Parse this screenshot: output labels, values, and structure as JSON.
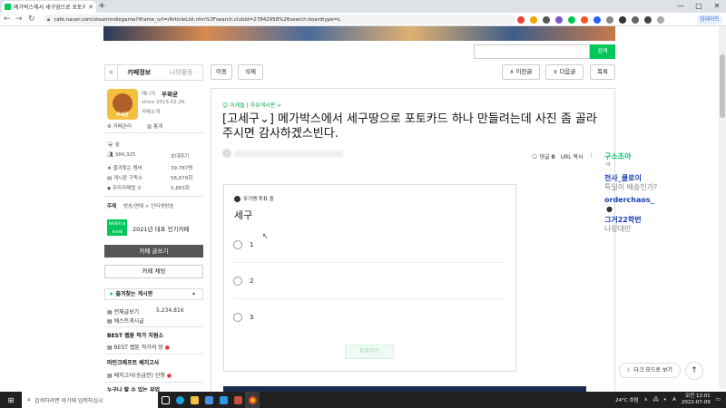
{
  "browser": {
    "tab_title": "메가박스에서 세구땅으로 포토카드",
    "new_tab": "+",
    "url": "cafe.naver.com/steamindiegame?iframe_url=/ArticleList.nhn%3Fsearch.clubid=27842958%26search.boardtype=L",
    "update_label": "업데이트"
  },
  "search": {
    "button": "검색",
    "placeholder": ""
  },
  "sidebar": {
    "tab_info": "카페정보",
    "tab_activity": "나의활동",
    "manager_label": "매니저",
    "manager_name": "우왁굳",
    "since": "since 2015.02.26.",
    "intro": "카페소개",
    "cafe_admin": "카페관리",
    "stats": "통계",
    "level": "숲",
    "members": "384,325",
    "invite": "초대하기",
    "fav_label": "즐겨찾는 멤버",
    "fav_count": "39,787명",
    "board_sub_label": "게시판 구독수",
    "board_sub_count": "56,679회",
    "visit_label": "우리카페앱 수",
    "visit_count": "5,883회",
    "topic_label": "주제",
    "topic_value": "방송/연예 > 인터넷방송",
    "naver_badge": "NAVER 대표카페",
    "popular": "2021년 대표 인기카페",
    "write_button": "카페 글쓰기",
    "chat_button": "카페 채팅",
    "fav_boards": "즐겨찾는 게시판",
    "all_posts": "전체글보기",
    "all_posts_count": "5,234,816",
    "best_posts": "베스트게시글",
    "best_section": "BEST 왭툰 작가 지원소",
    "best_room": "BEST 왭툰 작가의 방",
    "mc_section": "마인크래프트 베치고사",
    "mc_board": "베치고사(승급전) 신청",
    "more_section": "누구나 할 수 있는 부업"
  },
  "actions": {
    "move": "이동",
    "delete": "삭제",
    "prev": "이전글",
    "next": "다음글",
    "list": "목록"
  },
  "article": {
    "board": "이세돌 | 자유게시판 >",
    "title": "[고세구⌄] 메가박스에서 세구땅으로 포토카드 하나 만들려는데 사진 좀 골라주시면 감사하겠스빈다.",
    "comments_label": "댓글",
    "comments_count": "0",
    "url_copy": "URL 복사"
  },
  "vote": {
    "status": "우기땡 투표 중",
    "title": "세구",
    "options": [
      "1",
      "2",
      "3"
    ],
    "submit": "투표하기"
  },
  "overlay": [
    {
      "text": "구소조아",
      "color": "#0bbf6a",
      "bold": true
    },
    {
      "text": "ㅋ",
      "color": "#888",
      "bold": false
    },
    {
      "text": "천사_쿨로이",
      "color": "#1a3fb0",
      "bold": true
    },
    {
      "text": "특일이 배송인가?",
      "color": "#888",
      "bold": false
    },
    {
      "text": "orderchaos_",
      "color": "#1a3fb0",
      "bold": true
    },
    {
      "text": "●",
      "color": "#333",
      "bold": false
    },
    {
      "text": "그거22학번",
      "color": "#1a3fb0",
      "bold": true
    },
    {
      "text": "나랑대만",
      "color": "#888",
      "bold": false
    }
  ],
  "floating": {
    "dark_mode": "다크 모드로 보기",
    "top": "↑"
  },
  "taskbar": {
    "search_placeholder": "검색하려면 여기에 입력하십시",
    "weather": "24°C 흐림",
    "lang": "A",
    "time": "오전 12:01",
    "date": "2022-07-09"
  }
}
